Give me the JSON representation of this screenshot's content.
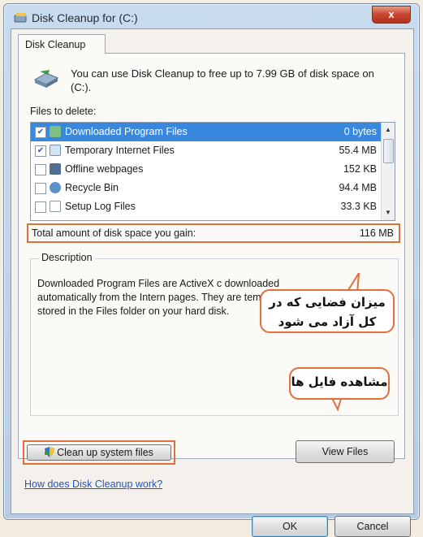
{
  "window": {
    "title": "Disk Cleanup for  (C:)",
    "close_label": "x"
  },
  "tab": {
    "label": "Disk Cleanup"
  },
  "header": {
    "text": "You can use Disk Cleanup to free up to 7.99 GB of disk space on  (C:)."
  },
  "files_label": "Files to delete:",
  "files": [
    {
      "name": "Downloaded Program Files",
      "size": "0 bytes",
      "checked": true,
      "selected": true
    },
    {
      "name": "Temporary Internet Files",
      "size": "55.4 MB",
      "checked": true,
      "selected": false
    },
    {
      "name": "Offline webpages",
      "size": "152 KB",
      "checked": false,
      "selected": false
    },
    {
      "name": "Recycle Bin",
      "size": "94.4 MB",
      "checked": false,
      "selected": false
    },
    {
      "name": "Setup Log Files",
      "size": "33.3 KB",
      "checked": false,
      "selected": false
    }
  ],
  "total": {
    "label": "Total amount of disk space you gain:",
    "value": "116 MB"
  },
  "description": {
    "title": "Description",
    "text": "Downloaded Program Files are ActiveX c downloaded automatically from the Intern pages. They are temporarily stored in the Files folder on your hard disk."
  },
  "buttons": {
    "cleanup": "Clean up system files",
    "view_files": "View Files",
    "ok": "OK",
    "cancel": "Cancel"
  },
  "help_link": "How does Disk Cleanup work?",
  "callouts": {
    "space": "میزان فضایی که در کل آزاد می شود",
    "view": "مشاهده فایل ها"
  },
  "colors": {
    "highlight": "#e06f3b",
    "selection": "#3a87de"
  }
}
